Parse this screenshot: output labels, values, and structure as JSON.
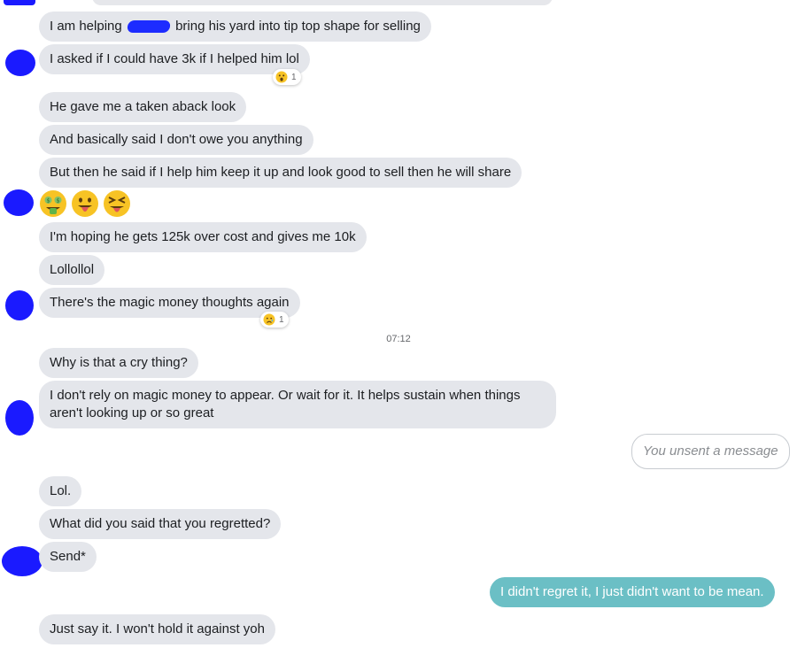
{
  "messages": {
    "m1_before": "I am helping",
    "m1_after": "bring his yard into tip top shape for selling",
    "m2": "I asked if I could have 3k if I helped him lol",
    "m3": "He gave me a taken aback look",
    "m4": "And basically said I don't owe you anything",
    "m5": "But then he said if I help him keep it up and look good to sell then he will share",
    "m6": "I'm hoping he gets 125k over cost and gives me 10k",
    "m7": "Lollollol",
    "m8": "There's the magic money thoughts again",
    "m9": "Why is that a cry thing?",
    "m10": "I don't rely on magic money to appear. Or wait for it. It helps sustain when things aren't looking up or so great",
    "unsent": "You unsent a message",
    "m11": "Lol.",
    "m12": "What did you said that you regretted?",
    "m13": "Send*",
    "out1": "I didn't regret it, I just didn't want to be mean.",
    "m14": "Just say it. I won't hold it against yoh"
  },
  "reactions": {
    "r1": {
      "emoji": "surprised-face",
      "count": "1"
    },
    "r2": {
      "emoji": "sad-face",
      "count": "1"
    }
  },
  "emoji_message": [
    "money-mouth-face",
    "tongue-out-face",
    "squinting-tongue-face"
  ],
  "timestamp": "07:12",
  "colors": {
    "incoming_bubble": "#e4e6eb",
    "outgoing_bubble": "#6bbfc5",
    "redaction": "#1d2cff"
  }
}
